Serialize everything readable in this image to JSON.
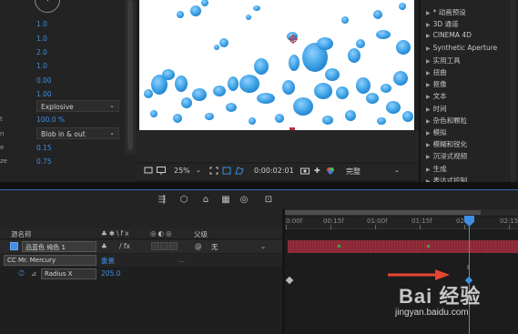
{
  "effect_controls": {
    "rows": [
      {
        "label": "",
        "value": "1.0"
      },
      {
        "label": "",
        "value": "1.0"
      },
      {
        "label": "",
        "value": "2.0"
      },
      {
        "label": "",
        "value": "1.0"
      },
      {
        "label": "",
        "value": "0.00"
      },
      {
        "label": "",
        "value": "1.00"
      }
    ],
    "selects": [
      {
        "label": "",
        "value": "Explosive"
      },
      {
        "label": "",
        "value": "Blob in & out"
      }
    ],
    "values2": [
      {
        "label": "",
        "value": "100.0 %"
      },
      {
        "label": "e",
        "value": "0.15"
      },
      {
        "label": "ze",
        "value": "0.75"
      }
    ],
    "short_labels": [
      "t",
      "n"
    ]
  },
  "viewer": {
    "zoom": "25%",
    "timecode": "0:00:02:01",
    "resolution": "完整"
  },
  "presets": {
    "items": [
      "* 动画预设",
      "3D 通道",
      "CINEMA 4D",
      "Synthetic Aperture",
      "实用工具",
      "扭曲",
      "抠像",
      "文本",
      "时间",
      "杂色和颗粒",
      "模拟",
      "模糊和锐化",
      "沉浸式视频",
      "生成",
      "表达式控制"
    ]
  },
  "timeline": {
    "headers": {
      "source_name": "源名称",
      "parent": "父级"
    },
    "layer": {
      "name": "品蓝色 纯色 1",
      "parent_value": "无"
    },
    "effect": {
      "name": "CC Mr. Mercury",
      "reset": "重置",
      "dots": "..."
    },
    "property": {
      "name": "Radius X",
      "value": "205.0"
    },
    "ruler": [
      "0:00f",
      "00:15f",
      "01:00f",
      "01:15f",
      "02:",
      "02:15"
    ]
  },
  "watermark": {
    "brand": "Bai 经验",
    "url": "jingyan.baidu.com"
  },
  "colors": {
    "accent": "#3d8fe6",
    "layer_bar": "#8c2735",
    "blob": "#3fa3e6",
    "arrow": "#e8452f"
  }
}
